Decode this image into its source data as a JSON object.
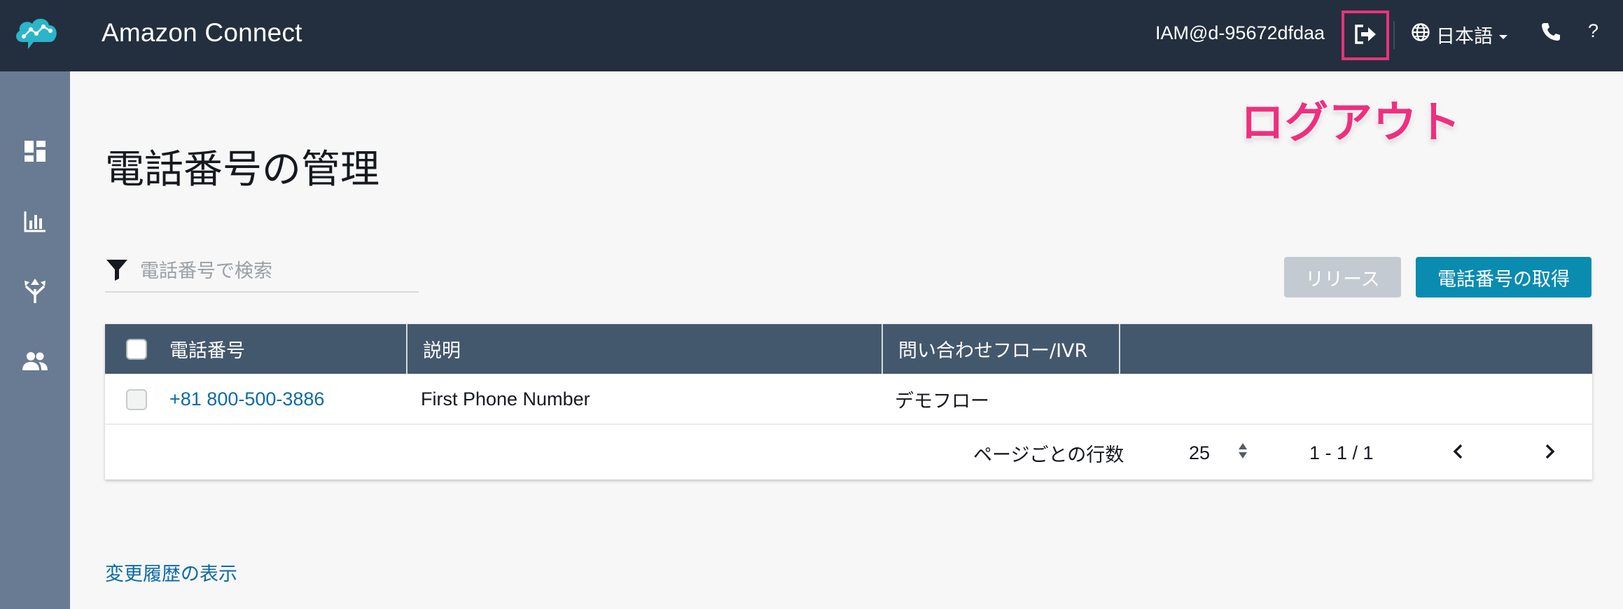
{
  "header": {
    "app_title": "Amazon Connect",
    "user": "IAM@d-95672dfdaa",
    "language": "日本語",
    "help": "?"
  },
  "annotation": "ログアウト",
  "sidebar": {
    "items": [
      {
        "icon": "dashboard-icon"
      },
      {
        "icon": "metrics-chart-icon"
      },
      {
        "icon": "routing-icon"
      },
      {
        "icon": "users-icon"
      }
    ]
  },
  "page": {
    "title": "電話番号の管理",
    "search_placeholder": "電話番号で検索",
    "release_label": "リリース",
    "acquire_label": "電話番号の取得",
    "history_link": "変更履歴の表示"
  },
  "table": {
    "columns": [
      "電話番号",
      "説明",
      "問い合わせフロー/IVR"
    ],
    "rows": [
      {
        "phone": "+81 800-500-3886",
        "description": "First Phone Number",
        "flow": "デモフロー"
      }
    ]
  },
  "pagination": {
    "rows_per_page_label": "ページごとの行数",
    "rows_per_page": "25",
    "range": "1 - 1 / 1"
  },
  "colors": {
    "header_bg": "#232f3e",
    "sidebar_bg": "#687b92",
    "table_header_bg": "#44586d",
    "primary_button": "#0a8bb0",
    "disabled_button": "#c4cad1",
    "link": "#0d6aa8",
    "annotation": "#ef2f7e",
    "logo": "#2bb5c9"
  }
}
